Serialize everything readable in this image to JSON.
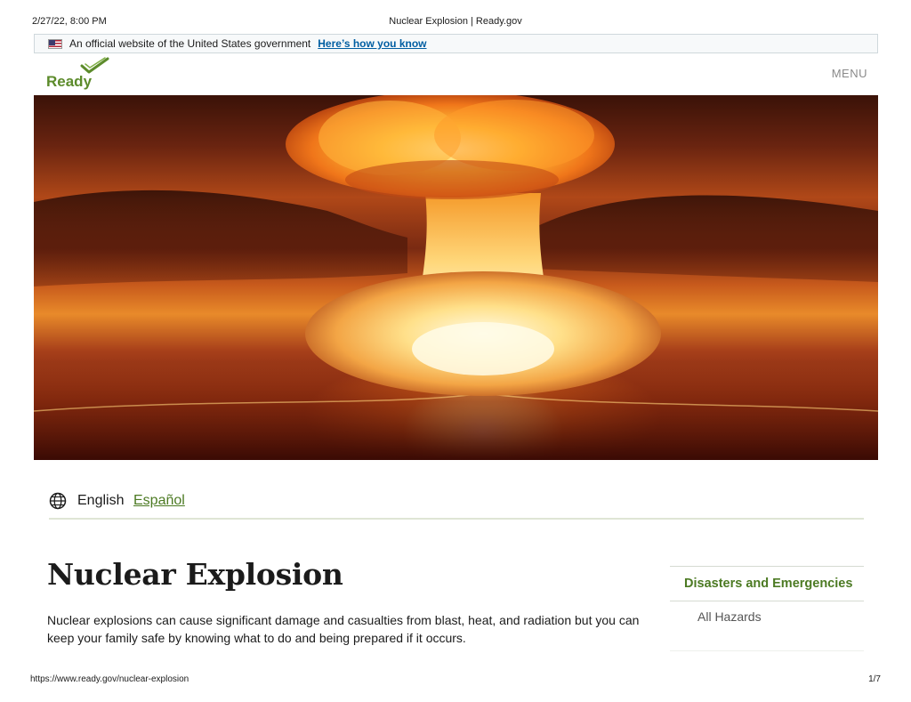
{
  "print_header": {
    "date": "2/27/22, 8:00 PM",
    "title": "Nuclear Explosion | Ready.gov"
  },
  "gov_banner": {
    "text": "An official website of the United States government",
    "link": "Here’s how you know",
    "flag_icon": "us-flag-icon"
  },
  "header": {
    "logo_text": "Ready",
    "logo_color": "#5c8b2b",
    "menu_label": "MENU"
  },
  "hero": {
    "image_subject": "nuclear-mushroom-cloud-image"
  },
  "language": {
    "icon": "globe-icon",
    "current": "English",
    "alternate": "Español"
  },
  "main": {
    "title": "Nuclear Explosion",
    "intro": "Nuclear explosions can cause significant damage and casualties from blast, heat, and radiation but you can keep your family safe by knowing what to do and being prepared if it occurs."
  },
  "side_nav": {
    "heading": "Disasters and Emergencies",
    "items": [
      {
        "label": "All Hazards"
      }
    ]
  },
  "print_footer": {
    "url": "https://www.ready.gov/nuclear-explosion",
    "page": "1/7"
  },
  "colors": {
    "accent_green": "#4c7a23",
    "link_blue": "#005ea2"
  }
}
